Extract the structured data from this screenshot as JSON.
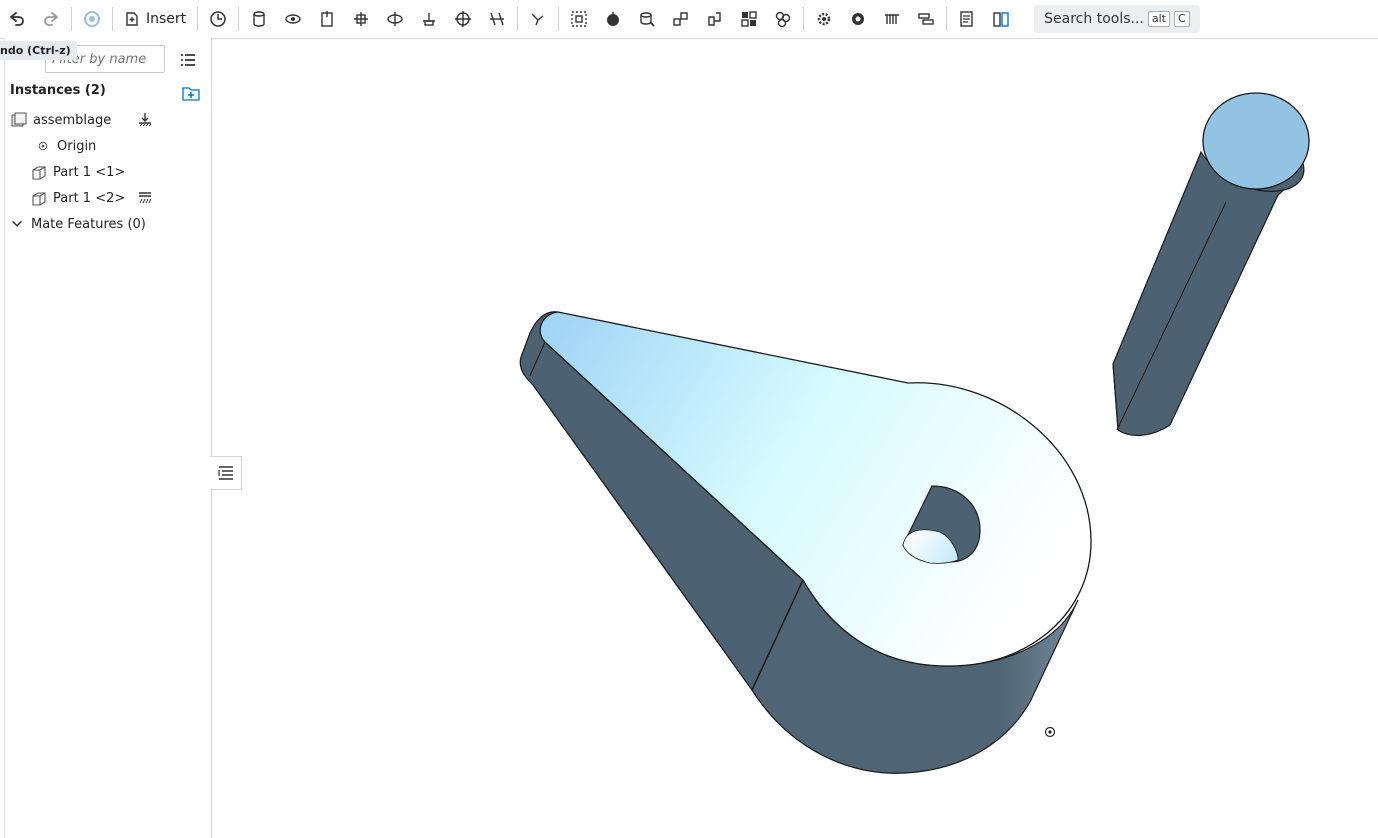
{
  "toolbar": {
    "undo_icon": "undo-icon",
    "redo_icon": "redo-icon",
    "insert_label": "Insert",
    "search_label": "Search tools...",
    "search_kbd1": "alt",
    "search_kbd2": "C"
  },
  "tooltip": {
    "text": "ndo (Ctrl-z)"
  },
  "panel": {
    "filter_placeholder": "Filter by name",
    "instances_title": "Instances (2)",
    "items": [
      {
        "label": "assemblage",
        "icon": "assembly-icon"
      },
      {
        "label": "Origin",
        "icon": "origin-icon"
      },
      {
        "label": "Part 1 <1>",
        "icon": "part-icon"
      },
      {
        "label": "Part 1 <2>",
        "icon": "part-icon"
      }
    ],
    "mate_features": "Mate Features (0)"
  },
  "colors": {
    "part_side": "#4e6373",
    "part_top_light": "#e9ffff",
    "part_top_blue": "#a8d6f7",
    "pin_cap": "#93c3e2",
    "accent": "#0077cc"
  }
}
